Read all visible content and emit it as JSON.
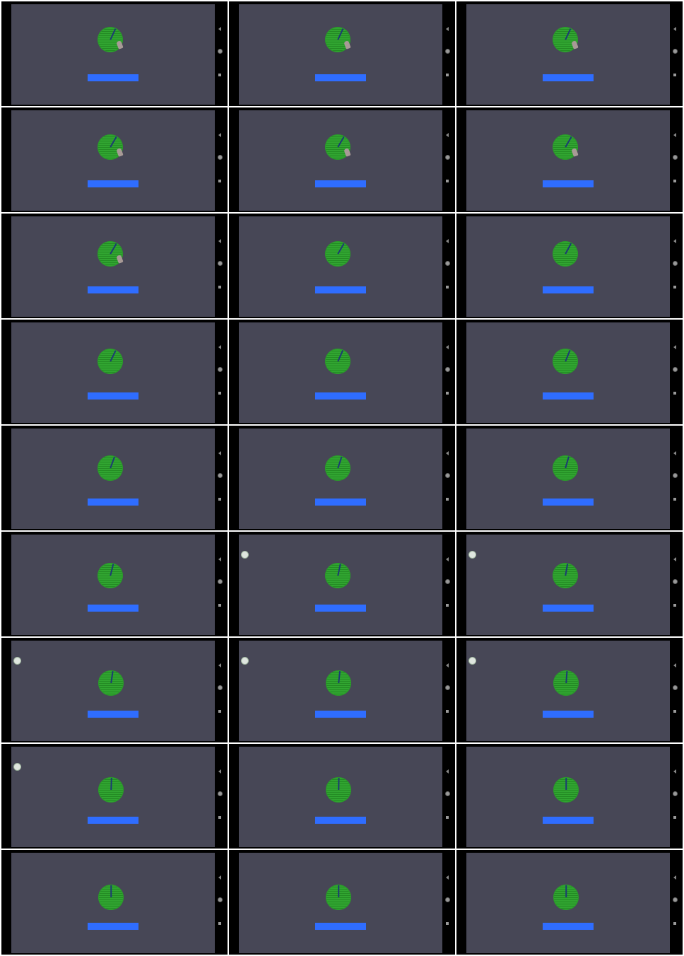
{
  "colors": {
    "frame_background": "#000000",
    "screen_background": "#474756",
    "dial": "#31a531",
    "dial_hand": "#1c3a74",
    "bar": "#2f6dff",
    "touch_indicator": "#dfe6df"
  },
  "icons": {
    "nav_back": "back-triangle",
    "nav_home": "home-circle",
    "nav_recent": "recent-square"
  },
  "frames": [
    {
      "hand_angle": 25,
      "touch": false,
      "pointer": true
    },
    {
      "hand_angle": 25,
      "touch": false,
      "pointer": true
    },
    {
      "hand_angle": 25,
      "touch": false,
      "pointer": true
    },
    {
      "hand_angle": 30,
      "touch": false,
      "pointer": true
    },
    {
      "hand_angle": 30,
      "touch": false,
      "pointer": true
    },
    {
      "hand_angle": 30,
      "touch": false,
      "pointer": true
    },
    {
      "hand_angle": 30,
      "touch": false,
      "pointer": true
    },
    {
      "hand_angle": 30,
      "touch": false,
      "pointer": false
    },
    {
      "hand_angle": 28,
      "touch": false,
      "pointer": false
    },
    {
      "hand_angle": 26,
      "touch": false,
      "pointer": false
    },
    {
      "hand_angle": 24,
      "touch": false,
      "pointer": false
    },
    {
      "hand_angle": 22,
      "touch": false,
      "pointer": false
    },
    {
      "hand_angle": 20,
      "touch": false,
      "pointer": false
    },
    {
      "hand_angle": 18,
      "touch": false,
      "pointer": false
    },
    {
      "hand_angle": 16,
      "touch": false,
      "pointer": false
    },
    {
      "hand_angle": 14,
      "touch": false,
      "pointer": false
    },
    {
      "hand_angle": 12,
      "touch": true,
      "pointer": false
    },
    {
      "hand_angle": 10,
      "touch": true,
      "pointer": false
    },
    {
      "hand_angle": 8,
      "touch": true,
      "pointer": false
    },
    {
      "hand_angle": 6,
      "touch": true,
      "pointer": false
    },
    {
      "hand_angle": 4,
      "touch": true,
      "pointer": false
    },
    {
      "hand_angle": 2,
      "touch": true,
      "pointer": false
    },
    {
      "hand_angle": 1,
      "touch": false,
      "pointer": false
    },
    {
      "hand_angle": 0,
      "touch": false,
      "pointer": false
    },
    {
      "hand_angle": 0,
      "touch": false,
      "pointer": false
    },
    {
      "hand_angle": 0,
      "touch": false,
      "pointer": false
    },
    {
      "hand_angle": 0,
      "touch": false,
      "pointer": false
    }
  ]
}
